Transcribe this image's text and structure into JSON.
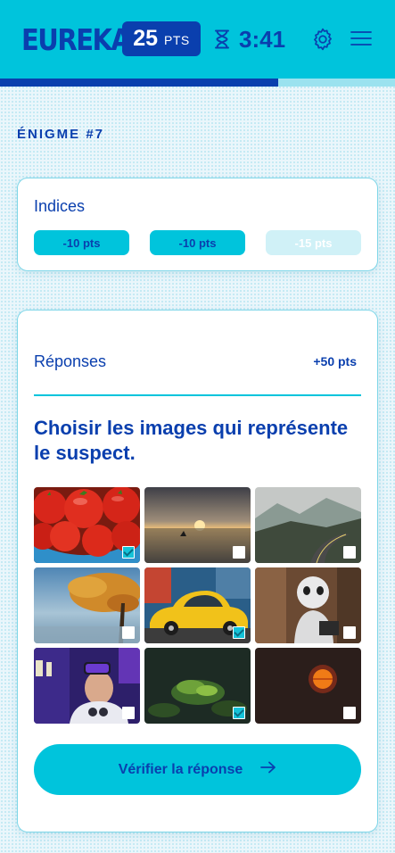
{
  "header": {
    "logo": "EUREKA",
    "score": {
      "value": "25",
      "unit": "PTS"
    },
    "timer": "3:41",
    "progress_fraction": 0.705
  },
  "puzzle": {
    "title": "ÉNIGME #7"
  },
  "hints": {
    "title": "Indices",
    "buttons": [
      {
        "label": "-10 pts",
        "enabled": true
      },
      {
        "label": "-10 pts",
        "enabled": true
      },
      {
        "label": "-15 pts",
        "enabled": false
      }
    ]
  },
  "answers": {
    "title": "Réponses",
    "points": "+50 pts",
    "question": "Choisir les images qui représente le suspect.",
    "images": [
      {
        "subject": "tomatoes",
        "checked": true
      },
      {
        "subject": "sunset-sea",
        "checked": false
      },
      {
        "subject": "mountain-road",
        "checked": false
      },
      {
        "subject": "autumn-tree-lake",
        "checked": false
      },
      {
        "subject": "yellow-car",
        "checked": true
      },
      {
        "subject": "robot",
        "checked": false
      },
      {
        "subject": "vr-headset-person",
        "checked": false
      },
      {
        "subject": "moss-plant",
        "checked": true
      },
      {
        "subject": "red-sun",
        "checked": false
      }
    ],
    "verify_label": "Vérifier la réponse"
  },
  "colors": {
    "brand_cyan": "#00c4dc",
    "brand_navy": "#0a3fae",
    "card_border": "#7fd6e8"
  }
}
